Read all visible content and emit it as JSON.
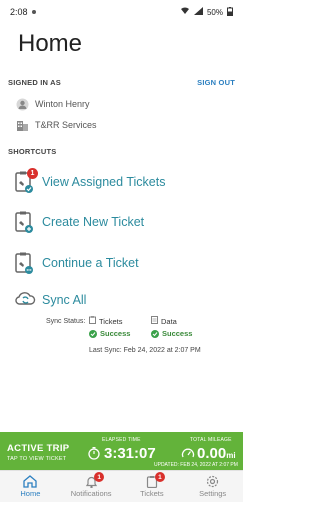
{
  "status_bar": {
    "time": "2:08",
    "battery": "50%"
  },
  "page": {
    "title": "Home"
  },
  "signed_in": {
    "header": "SIGNED IN AS",
    "signout_label": "SIGN OUT",
    "user_name": "Winton Henry",
    "company": "T&RR Services"
  },
  "shortcuts": {
    "header": "SHORTCUTS",
    "items": [
      {
        "label": "View Assigned Tickets",
        "badge": "1"
      },
      {
        "label": "Create New Ticket"
      },
      {
        "label": "Continue a Ticket"
      },
      {
        "label": "Sync All"
      }
    ]
  },
  "sync": {
    "status_label": "Sync Status:",
    "tickets_label": "Tickets",
    "data_label": "Data",
    "tickets_status": "Success",
    "data_status": "Success",
    "last_sync": "Last Sync: Feb 24, 2022 at 2:07 PM"
  },
  "active_trip": {
    "title": "ACTIVE TRIP",
    "subtitle": "TAP TO VIEW TICKET",
    "elapsed_label": "ELAPSED TIME",
    "elapsed_value": "3:31:07",
    "mileage_label": "TOTAL MILEAGE",
    "mileage_value": "0.00",
    "mileage_unit": "mi",
    "updated": "UPDATED: FEB 24, 2022 AT 2:07 PM"
  },
  "nav": {
    "items": [
      {
        "label": "Home"
      },
      {
        "label": "Notifications",
        "badge": "1"
      },
      {
        "label": "Tickets",
        "badge": "1"
      },
      {
        "label": "Settings"
      }
    ]
  },
  "colors": {
    "accent": "#2c8b9e",
    "link": "#2b7fc0",
    "trip": "#63b33a",
    "badge": "#d9302c"
  }
}
